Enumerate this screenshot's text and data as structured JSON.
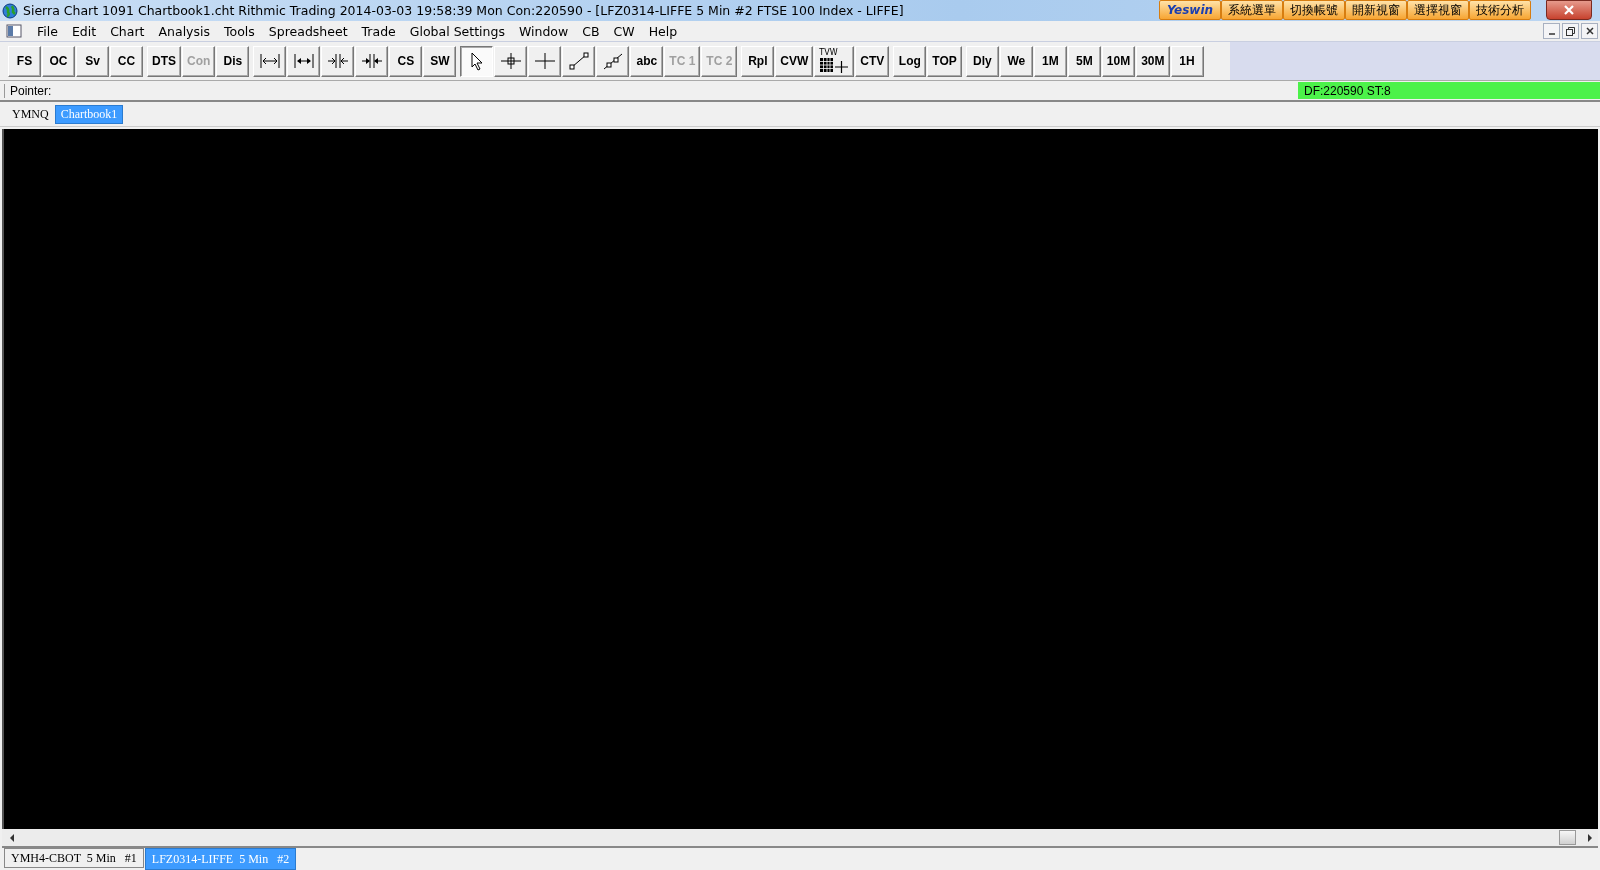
{
  "window": {
    "title": "Sierra Chart 1091 Chartbook1.cht  Rithmic Trading 2014-03-03  19:58:39 Mon  Con:220590 - [LFZ0314-LIFFE  5 Min   #2  FTSE 100 Index - LIFFE]"
  },
  "addon_buttons": [
    {
      "kind": "logo",
      "label": "Yeswin"
    },
    {
      "kind": "text",
      "label": "系統選單"
    },
    {
      "kind": "text",
      "label": "切換帳號"
    },
    {
      "kind": "text",
      "label": "開新視窗"
    },
    {
      "kind": "text",
      "label": "選擇視窗"
    },
    {
      "kind": "text",
      "label": "技術分析"
    }
  ],
  "menu": [
    "File",
    "Edit",
    "Chart",
    "Analysis",
    "Tools",
    "Spreadsheet",
    "Trade",
    "Global Settings",
    "Window",
    "CB",
    "CW",
    "Help"
  ],
  "toolbar_groups": [
    [
      {
        "kind": "text",
        "label": "FS",
        "disabled": false,
        "pressed": false
      },
      {
        "kind": "text",
        "label": "OC",
        "disabled": false,
        "pressed": false
      },
      {
        "kind": "text",
        "label": "Sv",
        "disabled": false,
        "pressed": false
      },
      {
        "kind": "text",
        "label": "CC",
        "disabled": false,
        "pressed": false
      }
    ],
    [
      {
        "kind": "text",
        "label": "DTS",
        "disabled": false,
        "pressed": false
      },
      {
        "kind": "text",
        "label": "Con",
        "disabled": true,
        "pressed": false
      },
      {
        "kind": "text",
        "label": "Dis",
        "disabled": false,
        "pressed": false
      }
    ],
    [
      {
        "kind": "icon",
        "pressed": false
      },
      {
        "kind": "icon",
        "pressed": false
      },
      {
        "kind": "icon",
        "pressed": false
      },
      {
        "kind": "icon",
        "pressed": false
      },
      {
        "kind": "text",
        "label": "CS",
        "disabled": false,
        "pressed": false
      },
      {
        "kind": "text",
        "label": "SW",
        "disabled": false,
        "pressed": false
      }
    ],
    [
      {
        "kind": "icon",
        "pressed": true
      },
      {
        "kind": "icon",
        "pressed": false
      },
      {
        "kind": "icon",
        "pressed": false
      },
      {
        "kind": "icon",
        "pressed": false
      },
      {
        "kind": "icon",
        "pressed": false
      },
      {
        "kind": "text",
        "label": "abc",
        "disabled": false,
        "pressed": false
      },
      {
        "kind": "text",
        "label": "TC 1",
        "disabled": true,
        "pressed": false
      },
      {
        "kind": "text",
        "label": "TC 2",
        "disabled": true,
        "pressed": false
      }
    ],
    [
      {
        "kind": "text",
        "label": "Rpl",
        "disabled": false,
        "pressed": false
      },
      {
        "kind": "text",
        "label": "CVW",
        "disabled": false,
        "pressed": false
      },
      {
        "kind": "icon",
        "caption": "TVW",
        "pressed": false
      },
      {
        "kind": "text",
        "label": "CTV",
        "disabled": false,
        "pressed": false
      }
    ],
    [
      {
        "kind": "text",
        "label": "Log",
        "disabled": false,
        "pressed": false
      },
      {
        "kind": "text",
        "label": "TOP",
        "disabled": false,
        "pressed": false
      }
    ],
    [
      {
        "kind": "text",
        "label": "Dly",
        "disabled": false,
        "pressed": false
      },
      {
        "kind": "text",
        "label": "We",
        "disabled": false,
        "pressed": false
      },
      {
        "kind": "text",
        "label": "1M",
        "disabled": false,
        "pressed": false
      },
      {
        "kind": "text",
        "label": "5M",
        "disabled": false,
        "pressed": false
      },
      {
        "kind": "text",
        "label": "10M",
        "disabled": false,
        "pressed": false
      },
      {
        "kind": "text",
        "label": "30M",
        "disabled": false,
        "pressed": false
      },
      {
        "kind": "text",
        "label": "1H",
        "disabled": false,
        "pressed": false
      }
    ]
  ],
  "status": {
    "pointer": "Pointer:",
    "data_feed": "DF:220590  ST:8"
  },
  "chartbook_tabs": [
    {
      "label": "YMNQ",
      "selected": false
    },
    {
      "label": "Chartbook1",
      "selected": true
    }
  ],
  "chart_tabs": [
    {
      "label": "YMH4-CBOT  5 Min   #1",
      "selected": false
    },
    {
      "label": "LFZ0314-LIFFE  5 Min   #2",
      "selected": true
    }
  ]
}
